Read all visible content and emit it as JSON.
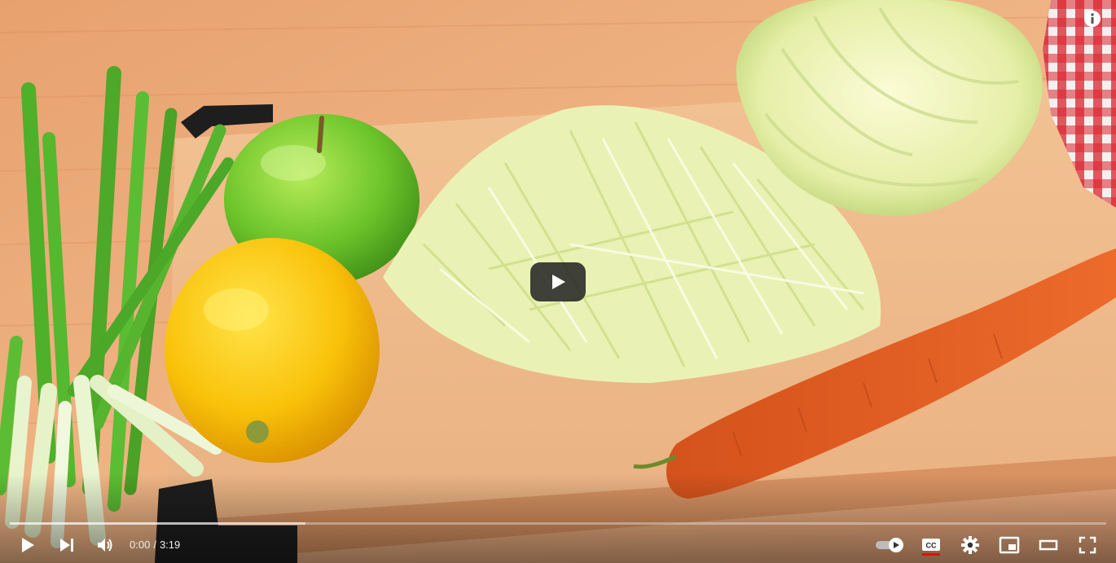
{
  "player": {
    "time": {
      "current": "0:00",
      "separator": "/",
      "duration": "3:19"
    },
    "progress": {
      "played_fraction": 0.0,
      "loaded_fraction": 0.27
    },
    "captions_underline_color": "#ff0000",
    "accent_color": "#ff0000",
    "icons": {
      "play": "play-icon",
      "next": "skip-next-icon",
      "volume": "volume-icon",
      "autoplay": "autoplay-toggle-icon",
      "captions": "cc-icon",
      "settings": "gear-icon",
      "miniplayer": "miniplayer-icon",
      "theater": "theater-mode-icon",
      "fullscreen": "fullscreen-icon",
      "info": "info-icon",
      "big_play": "big-play-icon"
    }
  }
}
